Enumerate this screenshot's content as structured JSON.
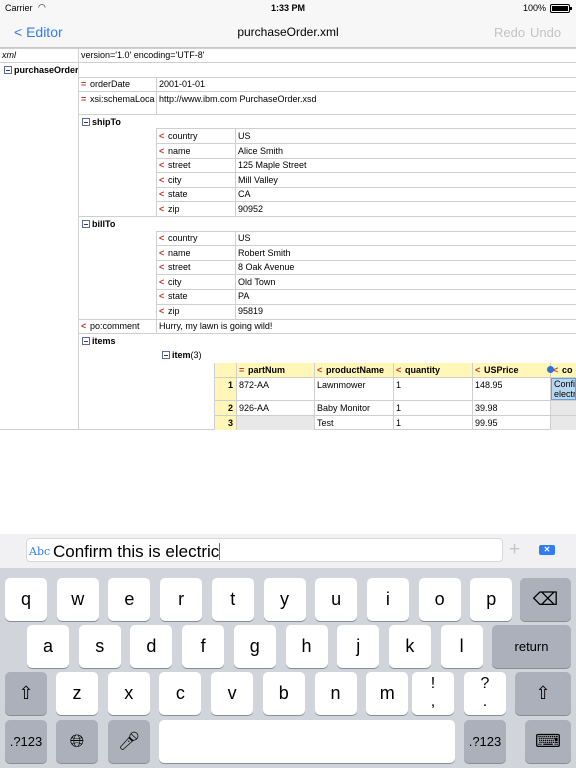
{
  "status": {
    "carrier": "Carrier",
    "time": "1:33 PM",
    "battery": "100%"
  },
  "nav": {
    "back": "< Editor",
    "title": "purchaseOrder.xml",
    "redo": "Redo",
    "undo": "Undo"
  },
  "tree": {
    "xml_label": "xml",
    "xml_value": "version='1.0' encoding='UTF-8'",
    "root": "purchaseOrder",
    "orderDate_label": "orderDate",
    "orderDate_value": "2001-01-01",
    "schema_label": "xsi:schemaLoca",
    "schema_value": "http://www.ibm.com PurchaseOrder.xsd",
    "shipTo": "shipTo",
    "ship_rows": [
      {
        "label": "country",
        "value": "US"
      },
      {
        "label": "name",
        "value": "Alice Smith"
      },
      {
        "label": "street",
        "value": "125 Maple Street"
      },
      {
        "label": "city",
        "value": "Mill Valley"
      },
      {
        "label": "state",
        "value": "CA"
      },
      {
        "label": "zip",
        "value": "90952"
      }
    ],
    "billTo": "billTo",
    "bill_rows": [
      {
        "label": "country",
        "value": "US"
      },
      {
        "label": "name",
        "value": "Robert Smith"
      },
      {
        "label": "street",
        "value": "8 Oak Avenue"
      },
      {
        "label": "city",
        "value": "Old Town"
      },
      {
        "label": "state",
        "value": "PA"
      },
      {
        "label": "zip",
        "value": "95819"
      }
    ],
    "comment_label": "po:comment",
    "comment_value": "Hurry, my lawn is going wild!",
    "items": "items",
    "item": "item",
    "item_count": "(3)",
    "columns": [
      "partNum",
      "productName",
      "quantity",
      "USPrice",
      "co"
    ],
    "rows": [
      {
        "num": "1",
        "cells": [
          "872-AA",
          "Lawnmower",
          "1",
          "148.95",
          "Confi electri"
        ]
      },
      {
        "num": "2",
        "cells": [
          "926-AA",
          "Baby Monitor",
          "1",
          "39.98",
          ""
        ]
      },
      {
        "num": "3",
        "cells": [
          "",
          "Test",
          "1",
          "99.95",
          ""
        ]
      }
    ]
  },
  "input": {
    "abc": "Abc",
    "text": "Confirm this is electric",
    "plus": "+"
  },
  "keyboard": {
    "row1": [
      "q",
      "w",
      "e",
      "r",
      "t",
      "y",
      "u",
      "i",
      "o",
      "p"
    ],
    "row2": [
      "a",
      "s",
      "d",
      "f",
      "g",
      "h",
      "j",
      "k",
      "l"
    ],
    "row3": [
      "z",
      "x",
      "c",
      "v",
      "b",
      "n",
      "m"
    ],
    "excl": "!",
    "comma": ",",
    "quest": "?",
    "period": ".",
    "return": "return",
    "num": ".?123"
  }
}
